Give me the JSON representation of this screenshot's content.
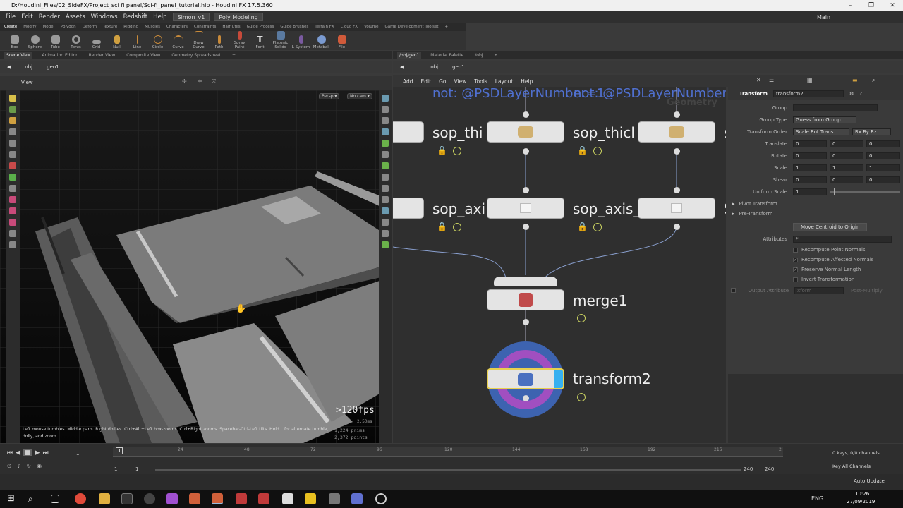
{
  "window": {
    "title": "D:/Houdini_Files/02_SideFX/Project_sci fi panel/Sci-fi_panel_tutorial.hip - Houdini FX 17.5.360",
    "controls": [
      "–",
      "❐",
      "✕"
    ]
  },
  "menubar": {
    "items": [
      "File",
      "Edit",
      "Render",
      "Assets",
      "Windows",
      "Redshift",
      "Help"
    ],
    "desktop": "Simon_v1",
    "mode": "Poly Modeling",
    "main": "Main"
  },
  "shelf_tabs": [
    "Create",
    "Modify",
    "Model",
    "Polygon",
    "Deform",
    "Texture",
    "Rigging",
    "Muscles",
    "Characters",
    "Constraints",
    "Hair Utils",
    "Guide Process",
    "Guide Brushes",
    "Terrain FX",
    "Cloud FX",
    "Volume",
    "Game Development Toolset",
    "+"
  ],
  "shelf_tools": [
    "Box",
    "Sphere",
    "Tube",
    "Torus",
    "Grid",
    "Null",
    "Line",
    "Circle",
    "Curve",
    "Draw Curve",
    "Path",
    "Spray Paint",
    "Font",
    "Platonic Solids",
    "L-System",
    "Metaball",
    "File"
  ],
  "left_pane": {
    "tabs": [
      "Scene View",
      "Animation Editor",
      "Render View",
      "Composite View",
      "Geometry Spreadsheet",
      "+"
    ],
    "path": [
      "obj",
      "geo1"
    ],
    "view_label": "View",
    "persp": "Persp ▾",
    "cam": "No cam ▾",
    "fps": ">120fps",
    "stats": [
      "2.50ms",
      "1,224 prims",
      "2,372 points"
    ],
    "hint": "Left mouse tumbles. Middle pans. Right dollies. Ctrl+Alt+Left box-zooms. Ctrl+Right zooms. Spacebar-Ctrl-Left tilts. Hold L for alternate tumble, dolly, and zoom."
  },
  "right_pane": {
    "tabs": [
      "/obj/geo1",
      "Material Palette",
      "/obj",
      "+"
    ],
    "path": [
      "obj",
      "geo1"
    ],
    "menu": [
      "Add",
      "Edit",
      "Go",
      "View",
      "Tools",
      "Layout",
      "Help"
    ],
    "overlay_text": [
      "not: @PSDLayerNumber=1",
      "not: @PSDLayerNumber"
    ],
    "watermark": "Geometry",
    "nodes": {
      "thick1": "sop_thi",
      "thick2": "sop_thicl",
      "axis1": "sop_axi",
      "axis2": "sop_axis_",
      "merge": "merge1",
      "transform": "transform2",
      "cut_s1": "s",
      "cut_s2": "S"
    }
  },
  "params": {
    "node_type": "Transform",
    "node_name": "transform2",
    "rows": [
      {
        "label": "Group",
        "values": [
          ""
        ]
      },
      {
        "label": "Group Type",
        "values": [
          "Guess from Group"
        ]
      },
      {
        "label": "Transform Order",
        "values": [
          "Scale Rot Trans",
          "Rx Ry Rz"
        ]
      },
      {
        "label": "Translate",
        "values": [
          "0",
          "0",
          "0"
        ]
      },
      {
        "label": "Rotate",
        "values": [
          "0",
          "0",
          "0"
        ]
      },
      {
        "label": "Scale",
        "values": [
          "1",
          "1",
          "1"
        ]
      },
      {
        "label": "Shear",
        "values": [
          "0",
          "0",
          "0"
        ]
      },
      {
        "label": "Uniform Scale",
        "values": [
          "1"
        ]
      }
    ],
    "pivot_transform": "Pivot Transform",
    "pre_transform": "Pre-Transform",
    "move_centroid": "Move Centroid to Origin",
    "attributes_label": "Attributes",
    "attributes_value": "*",
    "checks": [
      {
        "label": "Recompute Point Normals",
        "checked": false
      },
      {
        "label": "Recompute Affected Normals",
        "checked": true
      },
      {
        "label": "Preserve Normal Length",
        "checked": true
      },
      {
        "label": "Invert Transformation",
        "checked": false
      }
    ],
    "output_attribute": "Output Attribute",
    "output_value": "xform",
    "post_multiply": "Post-Multiply"
  },
  "timeline": {
    "ticks": [
      "1",
      "24",
      "48",
      "72",
      "96",
      "120",
      "144",
      "168",
      "192",
      "216",
      "2"
    ],
    "current_frame": "1",
    "start": "1",
    "start2": "1",
    "end": "240",
    "end2": "240",
    "keys_info": "0 keys, 0/0 channels",
    "key_all": "Key All Channels",
    "auto_update": "Auto Update"
  },
  "taskbar": {
    "lang": "ENG",
    "time": "10:26",
    "date": "27/09/2019"
  }
}
